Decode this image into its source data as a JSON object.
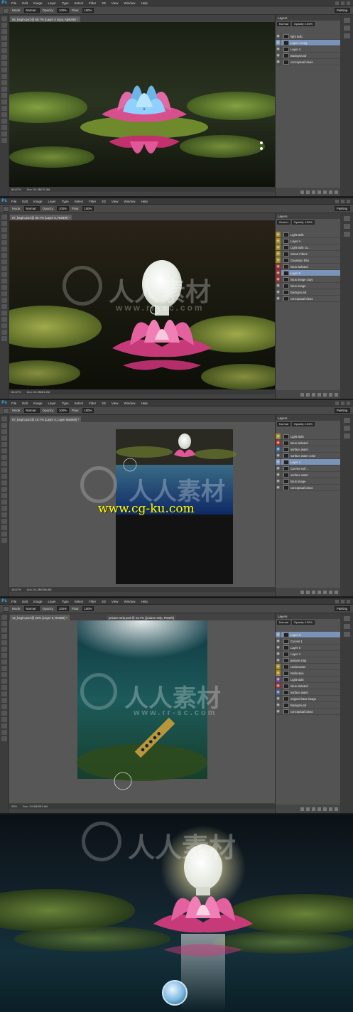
{
  "menu": [
    "File",
    "Edit",
    "Image",
    "Layer",
    "Type",
    "Select",
    "Filter",
    "3D",
    "View",
    "Window",
    "Help"
  ],
  "options": {
    "mode_label": "Mode:",
    "mode_value": "Normal",
    "opacity_label": "Opacity:",
    "opacity_value": "100%",
    "flow_label": "Flow:",
    "flow_value": "100%",
    "workspace": "Painting"
  },
  "panel1": {
    "doc_tab": "05_begin.psd @ 66.7% (Layer 4 copy, Alpha/8) *",
    "zoom": "66.67%",
    "doc": "Doc: 24.3M/75.3M",
    "layers_title": "Layers",
    "blend": "Normal",
    "opacity": "Opacity: 100%",
    "fill": "Fill: 100%",
    "layers": [
      {
        "name": "light bulb",
        "sel": false
      },
      {
        "name": "Layer 4 copy",
        "sel": true
      },
      {
        "name": "Layer 4",
        "sel": false
      },
      {
        "name": "Background",
        "sel": false
      },
      {
        "name": "conceptual ideas",
        "sel": false
      }
    ]
  },
  "panel2": {
    "doc_tab": "07_begin.psd @ 66.7% (Layer 5, RGB/8) *",
    "zoom": "66.67%",
    "doc": "Doc: 24.3M/84.2M",
    "layers_title": "Layers",
    "blend": "Screen",
    "opacity": "Opacity: 100%",
    "fill": "Fill: 100%",
    "layers": [
      {
        "name": "Light Bulb",
        "tag": "yellow"
      },
      {
        "name": "Layer 4",
        "tag": "yellow"
      },
      {
        "name": "Light Bulb co...",
        "tag": "yellow"
      },
      {
        "name": "Smart Filters",
        "tag": "yellow"
      },
      {
        "name": "Gaussian Blur",
        "tag": "yellow"
      },
      {
        "name": "lotus isolated",
        "tag": "red"
      },
      {
        "name": "Layer 5",
        "tag": "red",
        "sel": true
      },
      {
        "name": "lotus image copy",
        "tag": "red"
      },
      {
        "name": "lotus image"
      },
      {
        "name": "Background"
      },
      {
        "name": "conceptual ideas"
      }
    ]
  },
  "panel3": {
    "doc_tab": "07_begin.psd @ 16.7% (Layer 4, Layer Mask/8) *",
    "zoom": "16.67%",
    "doc": "Doc: 24.3M/386.8M",
    "layers_title": "Layers",
    "blend": "Normal",
    "opacity": "Opacity: 100%",
    "fill": "Fill: 100%",
    "layers": [
      {
        "name": "Light Bulb",
        "tag": "yellow"
      },
      {
        "name": "lotus isolated",
        "tag": "red"
      },
      {
        "name": "surface water",
        "tag": "blue"
      },
      {
        "name": "surface water color"
      },
      {
        "name": "Layer 4",
        "sel": true
      },
      {
        "name": "Curves surf..."
      },
      {
        "name": "surface water"
      },
      {
        "name": "lotus image"
      },
      {
        "name": "conceptual ideas"
      }
    ]
  },
  "panel4": {
    "doc_tab": "12_begin.psd @ 25% (Layer 6, RGB/8) *",
    "doc_tab2": "jesiane strip.psd @ 16.7% (jesiane strip, RGB/8)",
    "zoom": "25%",
    "doc": "Doc: 24.3M/331.4M",
    "layers_title": "Layers",
    "blend": "Normal",
    "opacity": "Opacity: 100%",
    "fill": "Fill: 100%",
    "layers": [
      {
        "name": "Layer 6",
        "sel": true
      },
      {
        "name": "Curves 1"
      },
      {
        "name": "Layer 5"
      },
      {
        "name": "Layer 4"
      },
      {
        "name": "jesiane strip"
      },
      {
        "name": "Underwater",
        "tag": "yellow"
      },
      {
        "name": "Reflection",
        "tag": "yellow"
      },
      {
        "name": "Light Bulb",
        "tag": "purple"
      },
      {
        "name": "lotus isolated",
        "tag": "red"
      },
      {
        "name": "surface water",
        "tag": "blue"
      },
      {
        "name": "original lotus image"
      },
      {
        "name": "Background"
      },
      {
        "name": "conceptual ideas"
      }
    ]
  },
  "watermark": {
    "site": "www.cg-ku.com",
    "cn": "人人素材",
    "url": "www.rr-sc.com"
  },
  "colors": {
    "accent": "#31a8ff",
    "selection": "#7a93b8",
    "site": "#ffff00"
  }
}
